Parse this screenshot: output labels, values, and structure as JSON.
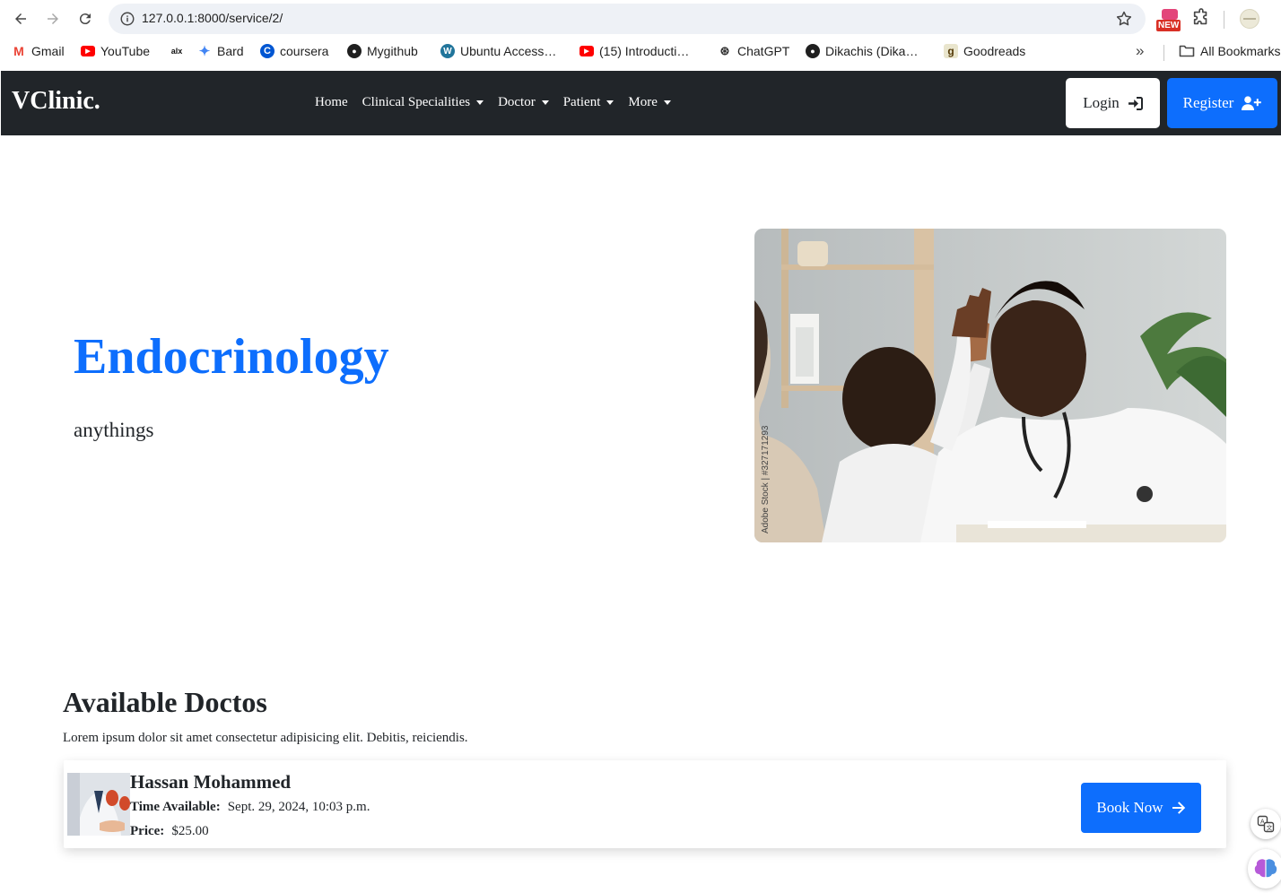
{
  "browser": {
    "url": "127.0.0.1:8000/service/2/",
    "new_badge": "NEW",
    "bookmarks": [
      {
        "label": "Gmail",
        "icon": "gmail-icon"
      },
      {
        "label": "YouTube",
        "icon": "youtube-icon"
      },
      {
        "label": "",
        "icon": "alx-icon"
      },
      {
        "label": "Bard",
        "icon": "bard-icon"
      },
      {
        "label": "coursera",
        "icon": "coursera-icon"
      },
      {
        "label": "Mygithub",
        "icon": "github-icon"
      },
      {
        "label": "Ubuntu Access…",
        "icon": "wordpress-icon"
      },
      {
        "label": "(15) Introducti…",
        "icon": "youtube-icon"
      },
      {
        "label": "ChatGPT",
        "icon": "chatgpt-icon"
      },
      {
        "label": "Dikachis (Dika…",
        "icon": "github-icon"
      },
      {
        "label": "Goodreads",
        "icon": "goodreads-icon"
      }
    ],
    "overflow": "»",
    "all_bookmarks": "All Bookmarks"
  },
  "navbar": {
    "brand": "VClinic.",
    "menu": [
      {
        "label": "Home",
        "dropdown": false
      },
      {
        "label": "Clinical Specialities",
        "dropdown": true
      },
      {
        "label": "Doctor",
        "dropdown": true
      },
      {
        "label": "Patient",
        "dropdown": true
      },
      {
        "label": "More",
        "dropdown": true
      }
    ],
    "login": "Login",
    "register": "Register"
  },
  "hero": {
    "title": "Endocrinology",
    "subtitle": "anythings",
    "watermark": "Adobe Stock | #327171293"
  },
  "doctors": {
    "title": "Available Doctos",
    "description": "Lorem ipsum dolor sit amet consectetur adipisicing elit. Debitis, reiciendis.",
    "items": [
      {
        "name": "Hassan Mohammed",
        "time_label": "Time Available:",
        "time_value": "Sept. 29, 2024, 10:03 p.m.",
        "price_label": "Price:",
        "price_value": "$25.00",
        "book_label": "Book Now"
      }
    ]
  },
  "colors": {
    "primary": "#0d6efd",
    "navbar_bg": "#212529"
  }
}
